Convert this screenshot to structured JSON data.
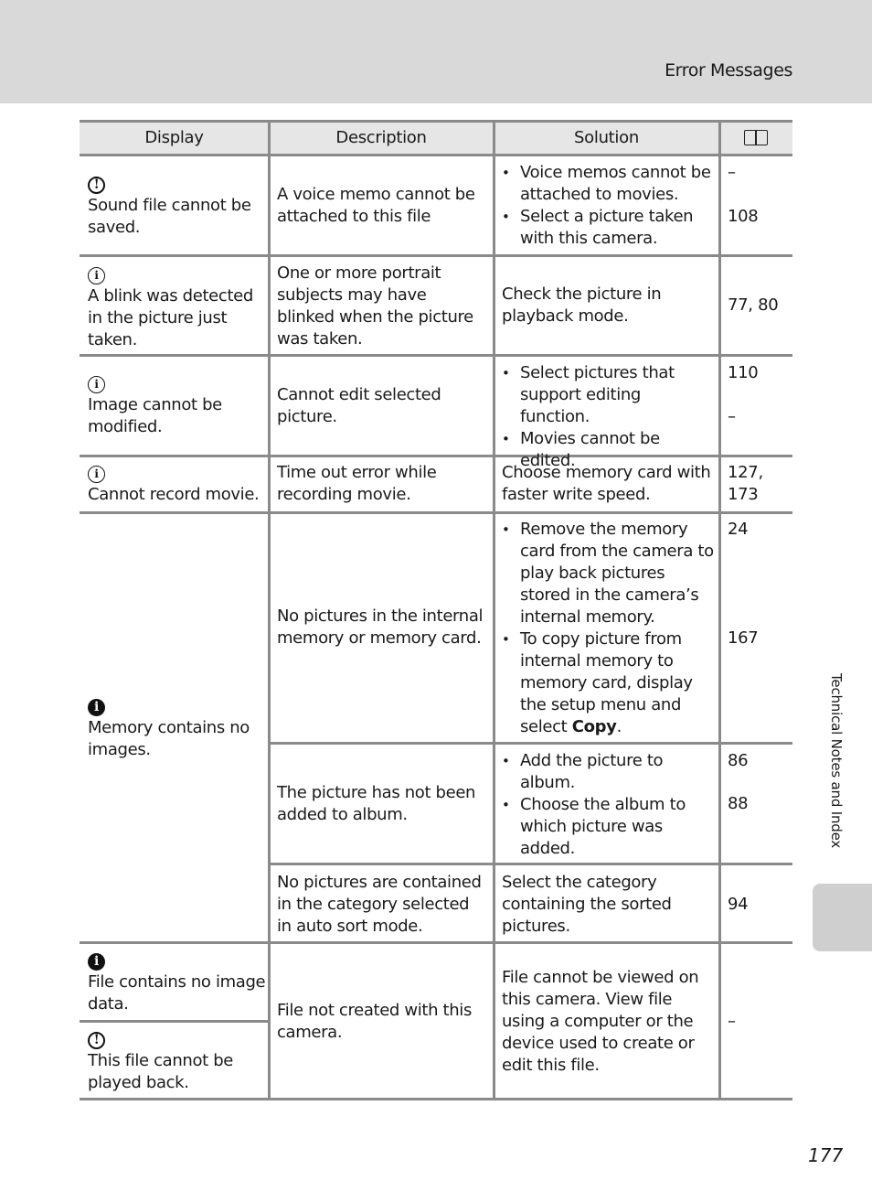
{
  "header": {
    "section_title": "Error Messages"
  },
  "side_tab": {
    "label": "Technical Notes and Index"
  },
  "page_number": "177",
  "table": {
    "columns": [
      "Display",
      "Description",
      "Solution",
      "book-reference-icon"
    ],
    "rows": [
      {
        "icon": "warning-icon",
        "display": "Sound file cannot be saved.",
        "description": "A voice memo cannot be attached to this file",
        "solution": [
          "Voice memos cannot be attached to movies.",
          "Select a picture taken with this camera."
        ],
        "refs": [
          "–",
          "108"
        ]
      },
      {
        "icon": "info-outline-icon",
        "display": "A blink was detected in the picture just taken.",
        "description": "One or more portrait subjects may have blinked when the picture was taken.",
        "solution": "Check the picture in playback mode.",
        "refs": [
          "77, 80"
        ]
      },
      {
        "icon": "info-outline-icon",
        "display": "Image cannot be modified.",
        "description": "Cannot edit selected picture.",
        "solution": [
          "Select pictures that support editing function.",
          "Movies cannot be edited."
        ],
        "refs": [
          "110",
          "–"
        ]
      },
      {
        "icon": "info-outline-icon",
        "display": "Cannot record movie.",
        "description": "Time out error while recording movie.",
        "solution": "Choose memory card with faster write speed.",
        "refs": [
          "127,",
          "173"
        ]
      },
      {
        "icon": "info-filled-icon",
        "display": "Memory contains no images.",
        "sub_rows": [
          {
            "description": "No pictures in the internal memory or memory card.",
            "solution": [
              "Remove the memory card from the camera to play back pictures stored in the camera’s internal memory.",
              "To copy picture from internal memory to memory card, display the setup menu and select"
            ],
            "solution_bold_tail": "Copy",
            "solution_tail_punct": ".",
            "refs": [
              "24",
              "167"
            ]
          },
          {
            "description": "The picture has not been added to album.",
            "solution": [
              "Add the picture to album.",
              "Choose the album to which picture was added."
            ],
            "refs": [
              "86",
              "88"
            ]
          },
          {
            "description": "No pictures are contained in the category selected in auto sort mode.",
            "solution": "Select the category containing the sorted pictures.",
            "refs": [
              "94"
            ]
          }
        ]
      },
      {
        "displays": [
          {
            "icon": "info-filled-icon",
            "display": "File contains no image data."
          },
          {
            "icon": "warning-icon",
            "display": "This file cannot be played back."
          }
        ],
        "description": "File not created with this camera.",
        "solution": "File cannot be viewed on this camera. View file using a computer or the device used to create or edit this file.",
        "refs": [
          "–"
        ]
      }
    ]
  },
  "icons": {
    "warning_glyph": "!",
    "info_glyph": "i"
  }
}
